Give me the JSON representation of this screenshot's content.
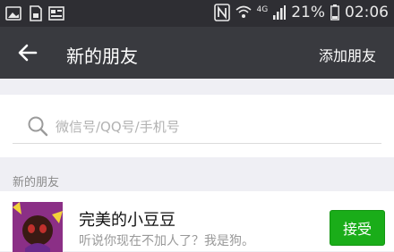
{
  "status_bar": {
    "network": "4G",
    "battery": "21%",
    "time": "02:06",
    "icons": [
      "gallery-icon",
      "sd-card-icon",
      "news-icon",
      "nfc-icon",
      "wifi-icon",
      "signal-icon",
      "battery-icon"
    ]
  },
  "header": {
    "title": "新的朋友",
    "add_label": "添加朋友"
  },
  "search": {
    "placeholder": "微信号/QQ号/手机号"
  },
  "section": {
    "label": "新的朋友"
  },
  "requests": [
    {
      "name": "完美的小豆豆",
      "message": "听说你现在不加人了？我是狗。",
      "action": "接受"
    }
  ],
  "colors": {
    "status_bar": "#2e2e33",
    "title_bar": "#393a3f",
    "accept_button": "#1aad19",
    "page_background": "#efeff4"
  }
}
